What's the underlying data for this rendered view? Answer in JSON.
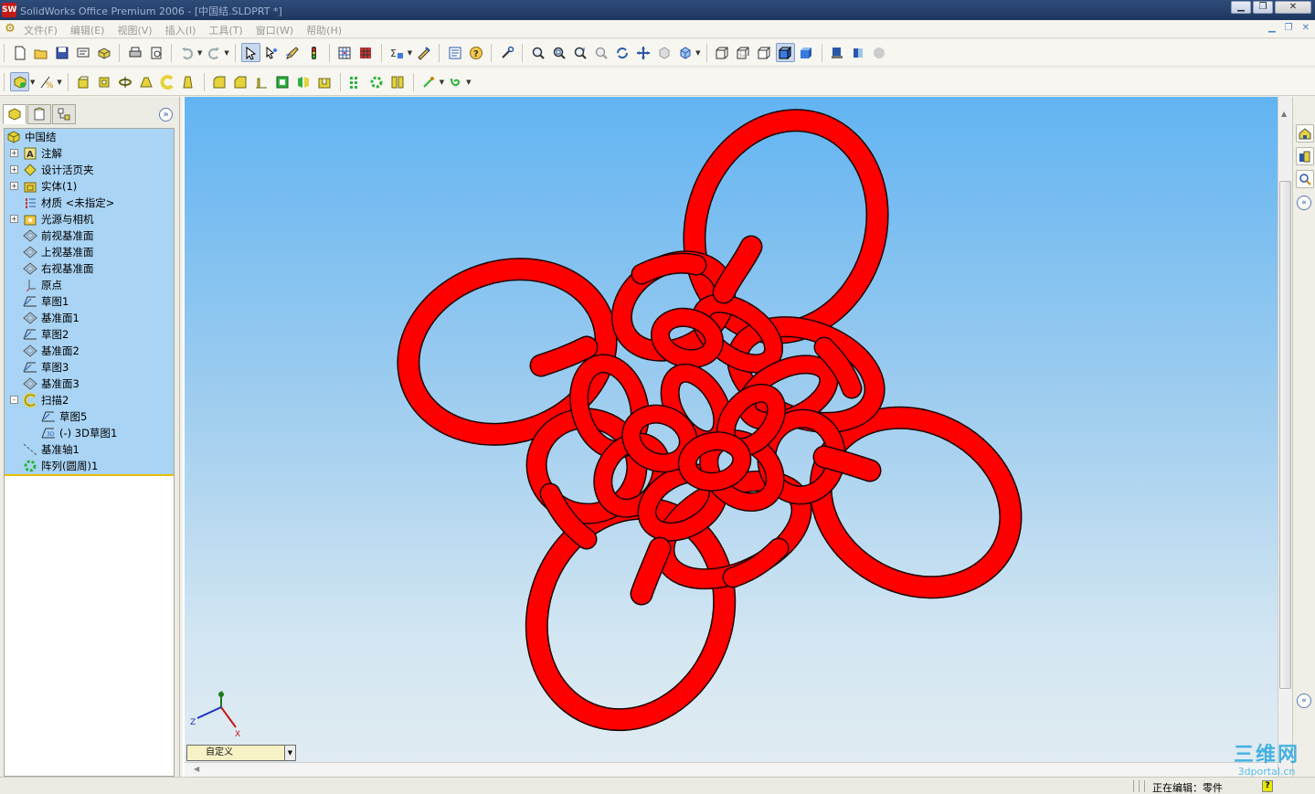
{
  "window": {
    "title": "SolidWorks Office Premium 2006 - [中国结.SLDPRT *]",
    "logo_text": "SW",
    "buttons": {
      "minimize": "▁",
      "restore": "❐",
      "close": "✕"
    }
  },
  "menu": {
    "items": [
      "文件(F)",
      "编辑(E)",
      "视图(V)",
      "插入(I)",
      "工具(T)",
      "窗口(W)",
      "帮助(H)"
    ],
    "mdi_buttons": [
      "▁",
      "❐",
      "✕"
    ]
  },
  "feature_manager": {
    "tabs": [
      "feature-manager-tab",
      "property-manager-tab",
      "configuration-manager-tab"
    ],
    "collapse_label": "»",
    "root": "中国结",
    "items": [
      {
        "label": "注解",
        "icon": "annotation-icon",
        "expander": "+"
      },
      {
        "label": "设计活页夹",
        "icon": "design-binder-icon",
        "expander": "+"
      },
      {
        "label": "实体(1)",
        "icon": "solid-body-icon",
        "expander": "+"
      },
      {
        "label": "材质 <未指定>",
        "icon": "material-icon",
        "expander": ""
      },
      {
        "label": "光源与相机",
        "icon": "lights-cameras-icon",
        "expander": "+"
      },
      {
        "label": "前视基准面",
        "icon": "plane-icon",
        "expander": ""
      },
      {
        "label": "上视基准面",
        "icon": "plane-icon",
        "expander": ""
      },
      {
        "label": "右视基准面",
        "icon": "plane-icon",
        "expander": ""
      },
      {
        "label": "原点",
        "icon": "origin-icon",
        "expander": ""
      },
      {
        "label": "草图1",
        "icon": "sketch-icon",
        "expander": ""
      },
      {
        "label": "基准面1",
        "icon": "plane-icon",
        "expander": ""
      },
      {
        "label": "草图2",
        "icon": "sketch-icon",
        "expander": ""
      },
      {
        "label": "基准面2",
        "icon": "plane-icon",
        "expander": ""
      },
      {
        "label": "草图3",
        "icon": "sketch-icon",
        "expander": ""
      },
      {
        "label": "基准面3",
        "icon": "plane-icon",
        "expander": ""
      },
      {
        "label": "扫描2",
        "icon": "sweep-icon",
        "expander": "-"
      },
      {
        "label": "草图5",
        "icon": "sketch-icon",
        "expander": "",
        "child": true
      },
      {
        "label": "(-) 3D草图1",
        "icon": "3d-sketch-icon",
        "expander": "",
        "child": true
      },
      {
        "label": "基准轴1",
        "icon": "axis-icon",
        "expander": ""
      },
      {
        "label": "阵列(圆周)1",
        "icon": "circular-pattern-icon",
        "expander": ""
      }
    ]
  },
  "viewport": {
    "view_orientation": "自定义",
    "triad": {
      "x": "X",
      "y": "Y",
      "z": "Z"
    },
    "model_color": "#ff0000",
    "background_top": "#62b4f2",
    "background_bottom": "#e2ecf2"
  },
  "status": {
    "text": "正在编辑：零件",
    "help": "?"
  },
  "watermark": {
    "big": "三维网",
    "small": "3dportal.cn"
  },
  "colors": {
    "tree_highlight": "#a9d4f5",
    "rollback_bar": "#e8c000",
    "title_bar": "#1d3760"
  }
}
